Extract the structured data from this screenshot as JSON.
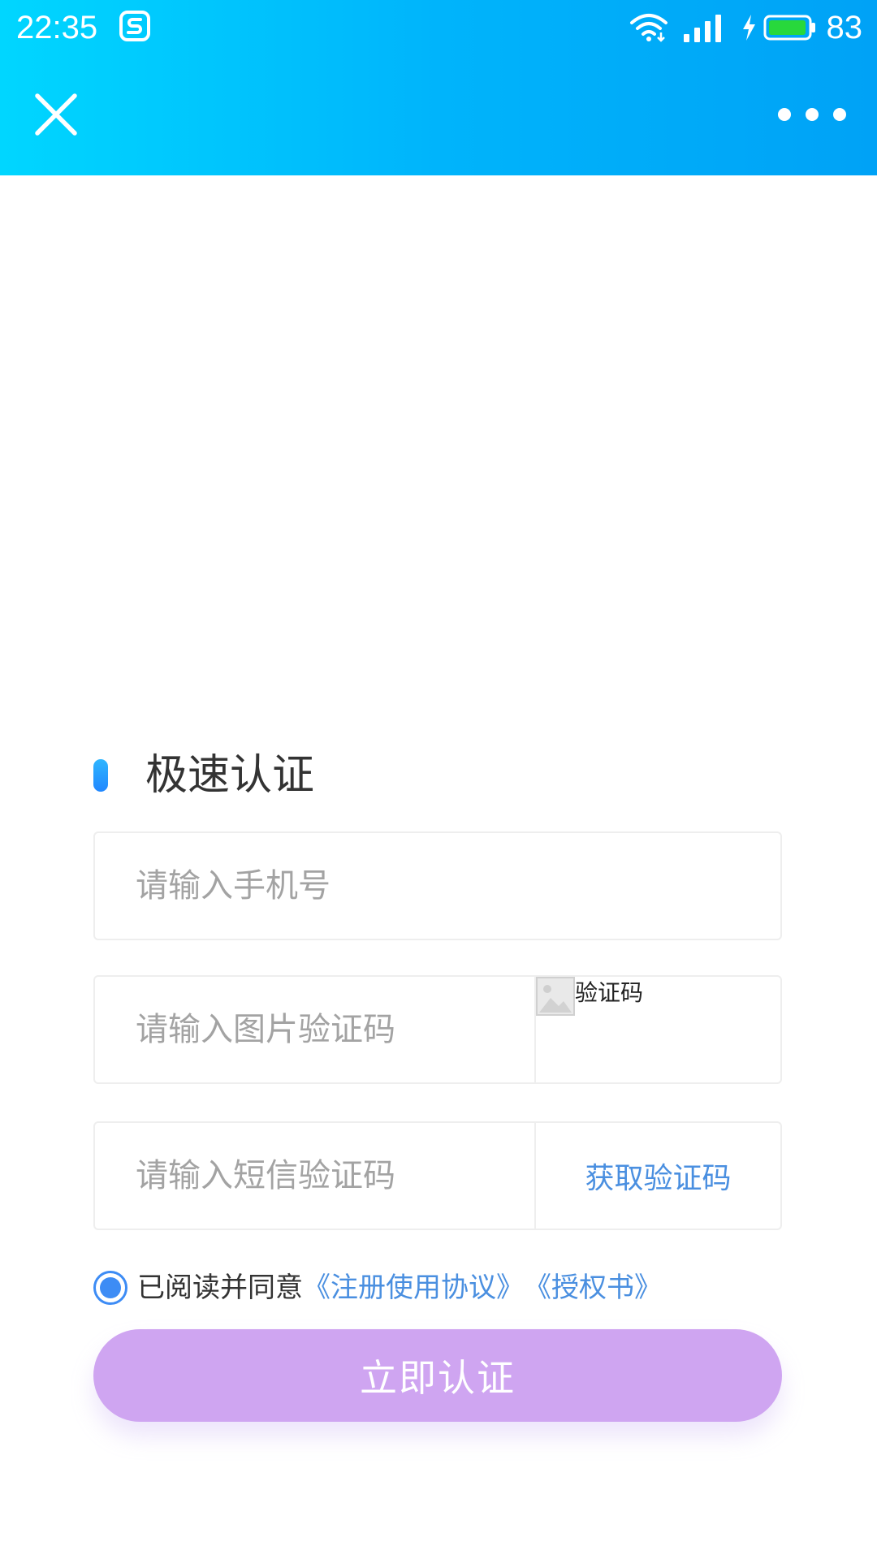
{
  "status_bar": {
    "time": "22:35",
    "battery_percent": "83",
    "app_icon": "sogou-s-icon",
    "icons": [
      "wifi-icon",
      "signal-icon",
      "charging-icon",
      "battery-icon"
    ]
  },
  "app_bar": {
    "close_icon": "close-icon",
    "more_icon": "more-dots-icon"
  },
  "form": {
    "title": "极速认证",
    "phone_placeholder": "请输入手机号",
    "captcha_placeholder": "请输入图片验证码",
    "captcha_alt_text": "验证码",
    "sms_placeholder": "请输入短信验证码",
    "get_code_label": "获取验证码",
    "agree_prefix": "已阅读并同意",
    "agreement_link": "《注册使用协议》",
    "authorization_link": "《授权书》",
    "submit_label": "立即认证"
  },
  "colors": {
    "header_gradient_start": "#00d6ff",
    "header_gradient_end": "#00a2f6",
    "link_blue": "#4a8fe0",
    "radio_blue": "#3d8cf5",
    "submit_purple": "#cfa5f1"
  }
}
